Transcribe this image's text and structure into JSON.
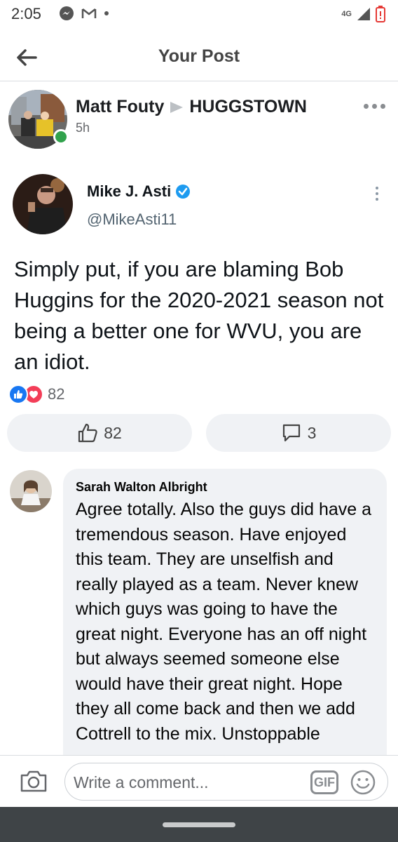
{
  "status_bar": {
    "time": "2:05",
    "icons": [
      "messenger-icon",
      "gmail-icon",
      "dot-icon",
      "4g-lte-icon",
      "signal-icon",
      "battery-low-icon"
    ],
    "network_label": "4G"
  },
  "header": {
    "title": "Your Post",
    "back_icon": "arrow-left-icon"
  },
  "post": {
    "author": "Matt Fouty",
    "target_group": "HUGGSTOWN",
    "time": "5h",
    "online": true
  },
  "tweet": {
    "name": "Mike J. Asti",
    "verified": true,
    "handle": "@MikeAsti11",
    "text": "Simply put, if you are blaming Bob Huggins for the 2020-2021 season not being a better one for WVU, you are an idiot."
  },
  "reactions": {
    "types": [
      "like",
      "love"
    ],
    "count": "82",
    "colors": {
      "like": "#1877f2",
      "love": "#f33e58"
    }
  },
  "actions": {
    "like_count": "82",
    "comment_count": "3"
  },
  "comment": {
    "author": "Sarah Walton Albright",
    "text": "Agree totally. Also the guys did have a tremendous season. Have enjoyed this team. They are unselfish and really played as a team. Never knew which guys was going to have the great night. Everyone has an off night but always seemed someone else would have their great night. Hope they all come back and then we add Cottrell to the mix. Unstoppable"
  },
  "composer": {
    "placeholder": "Write a comment...",
    "gif_label": "GIF"
  }
}
